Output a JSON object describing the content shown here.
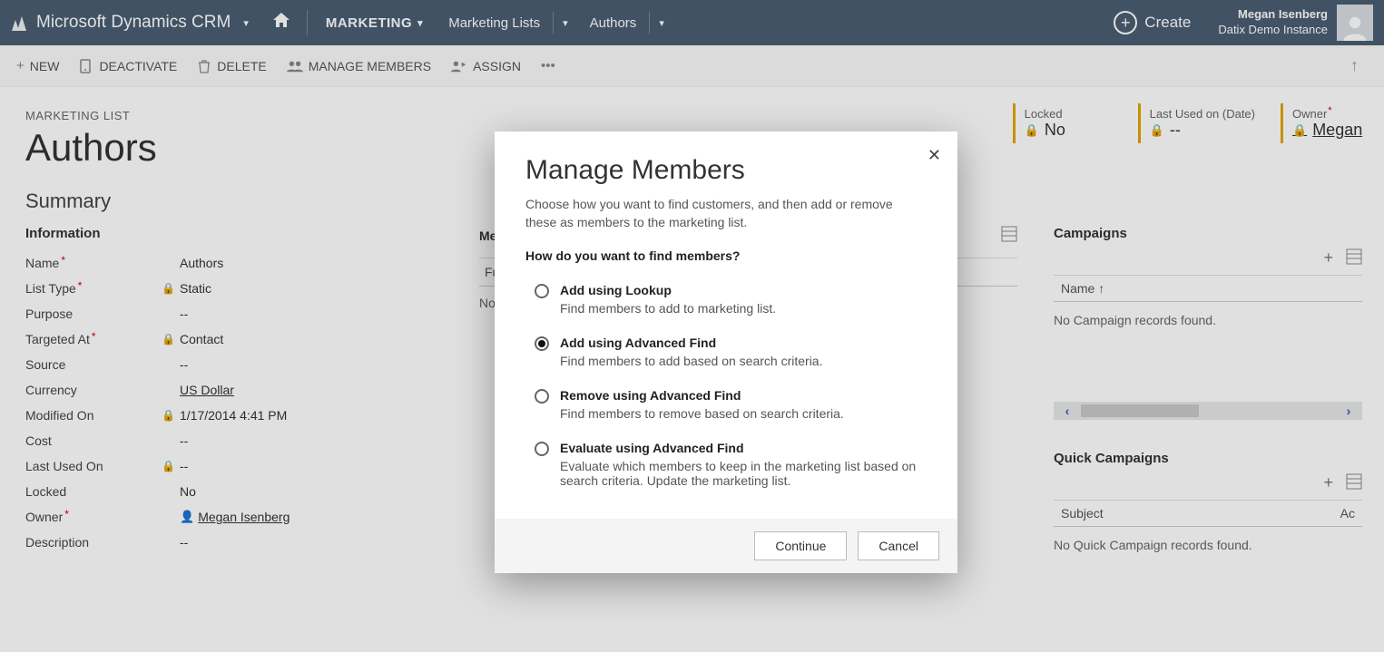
{
  "nav": {
    "brand": "Microsoft Dynamics CRM",
    "area": "MARKETING",
    "crumb1": "Marketing Lists",
    "crumb2": "Authors",
    "create": "Create",
    "user_name": "Megan Isenberg",
    "org": "Datix Demo Instance"
  },
  "commands": {
    "new": "NEW",
    "deactivate": "DEACTIVATE",
    "delete": "DELETE",
    "manage": "MANAGE MEMBERS",
    "assign": "ASSIGN"
  },
  "record": {
    "type_label": "MARKETING LIST",
    "title": "Authors",
    "summary": "Summary",
    "info_head": "Information"
  },
  "fields": {
    "name_lbl": "Name",
    "name_val": "Authors",
    "listtype_lbl": "List Type",
    "listtype_val": "Static",
    "purpose_lbl": "Purpose",
    "purpose_val": "--",
    "targeted_lbl": "Targeted At",
    "targeted_val": "Contact",
    "source_lbl": "Source",
    "source_val": "--",
    "currency_lbl": "Currency",
    "currency_val": "US Dollar",
    "modified_lbl": "Modified On",
    "modified_val": "1/17/2014  4:41 PM",
    "cost_lbl": "Cost",
    "cost_val": "--",
    "lastused_lbl": "Last Used On",
    "lastused_val": "--",
    "locked_lbl": "Locked",
    "locked_val": "No",
    "owner_lbl": "Owner",
    "owner_val": "Megan Isenberg",
    "desc_lbl": "Description",
    "desc_val": "--"
  },
  "members": {
    "head": "Members",
    "col": "Full Name",
    "empty": "No Contact records found."
  },
  "header_pills": {
    "locked_lbl": "Locked",
    "locked_val": "No",
    "lastused_lbl": "Last Used on (Date)",
    "lastused_val": "--",
    "owner_lbl": "Owner",
    "owner_val": "Megan"
  },
  "right": {
    "campaigns_head": "Campaigns",
    "campaigns_col": "Name ↑",
    "campaigns_empty": "No Campaign records found.",
    "qcampaigns_head": "Quick Campaigns",
    "qcampaigns_col_subject": "Subject",
    "qcampaigns_col_ac": "Ac",
    "qcampaigns_empty": "No Quick Campaign records found."
  },
  "modal": {
    "title": "Manage Members",
    "subtitle": "Choose how you want to find customers, and then add or remove these as members to the marketing list.",
    "question": "How do you want to find members?",
    "options": [
      {
        "title": "Add using Lookup",
        "desc": "Find members to add to marketing list.",
        "selected": false
      },
      {
        "title": "Add using Advanced Find",
        "desc": "Find members to add based on search criteria.",
        "selected": true
      },
      {
        "title": "Remove using Advanced Find",
        "desc": "Find members to remove based on search criteria.",
        "selected": false
      },
      {
        "title": "Evaluate using Advanced Find",
        "desc": "Evaluate which members to keep in the marketing list based on search criteria. Update the marketing list.",
        "selected": false
      }
    ],
    "continue": "Continue",
    "cancel": "Cancel"
  }
}
